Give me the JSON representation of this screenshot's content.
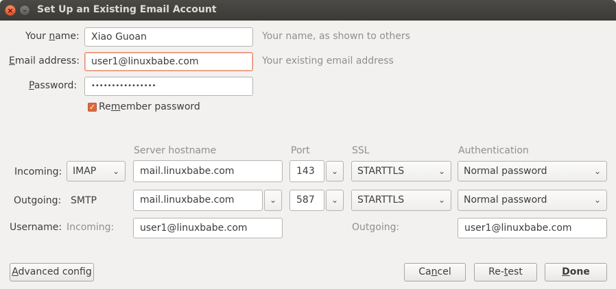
{
  "window": {
    "title": "Set Up an Existing Email Account"
  },
  "identity": {
    "name_label_pre": "Your ",
    "name_label_u": "n",
    "name_label_post": "ame:",
    "name_value": "Xiao Guoan",
    "name_hint": "Your name, as shown to others",
    "email_label_u": "E",
    "email_label_post": "mail address:",
    "email_value": "user1@linuxbabe.com",
    "email_hint": "Your existing email address",
    "password_label_u": "P",
    "password_label_post": "assword:",
    "password_value": "••••••••••••••••",
    "remember_pre": "Re",
    "remember_u": "m",
    "remember_post": "ember password",
    "remember_checked": true
  },
  "columns": {
    "hostname": "Server hostname",
    "port": "Port",
    "ssl": "SSL",
    "auth": "Authentication"
  },
  "incoming": {
    "label": "Incoming:",
    "protocol": "IMAP",
    "hostname": "mail.linuxbabe.com",
    "port": "143",
    "ssl": "STARTTLS",
    "auth": "Normal password"
  },
  "outgoing": {
    "label": "Outgoing:",
    "protocol": "SMTP",
    "hostname": "mail.linuxbabe.com",
    "port": "587",
    "ssl": "STARTTLS",
    "auth": "Normal password"
  },
  "username": {
    "label": "Username:",
    "incoming_label": "Incoming:",
    "incoming_value": "user1@linuxbabe.com",
    "outgoing_label": "Outgoing:",
    "outgoing_value": "user1@linuxbabe.com"
  },
  "buttons": {
    "advanced_u": "A",
    "advanced_post": "dvanced config",
    "cancel_pre": "Ca",
    "cancel_u": "n",
    "cancel_post": "cel",
    "retest_pre": "Re-",
    "retest_u": "t",
    "retest_post": "est",
    "done_u": "D",
    "done_post": "one"
  },
  "icons": {
    "dropdown": "chevron-down-icon",
    "close": "close-icon",
    "minimize": "minimize-icon",
    "check": "checkmark-icon"
  },
  "colors": {
    "accent": "#e0683a",
    "titlebar": "#3c3b37"
  }
}
